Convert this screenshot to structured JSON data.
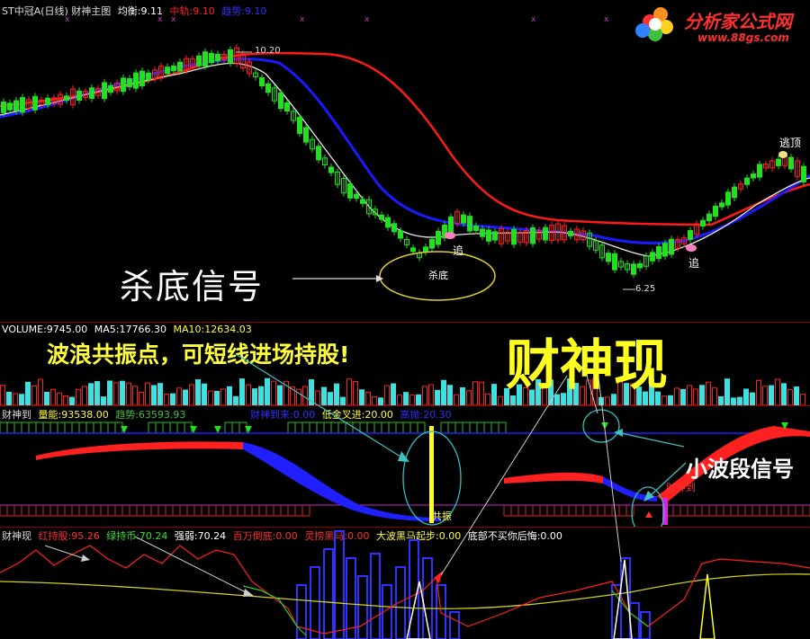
{
  "main": {
    "title": "ST中冠A(日线) 财神主图",
    "avg_label": "均衡:9.11",
    "mid_label": "中轨:9.10",
    "trend_label": "趋势:9.10",
    "high_label": "10.20",
    "low_label": "6.25",
    "chase1": "追",
    "chase2": "追",
    "kill_bottom": "杀底",
    "escape_top": "逃顶",
    "annotation_kill": "杀底信号"
  },
  "volume": {
    "vol_label": "VOLUME:9745.00",
    "ma5_label": "MA5:17766.30",
    "ma10_label": "MA10:12634.03"
  },
  "caishendao": {
    "title": "财神到",
    "energy_label": "量能:93538.00",
    "trend_label": "趋势:63593.93",
    "appear_label": "财神到来:0.00",
    "golden_label": "低金叉进:20.00",
    "high_label": "高抛:20.30",
    "resonance": "共振",
    "arrive": "财神到"
  },
  "caishenxian": {
    "title": "财神现",
    "red_label": "红持股:95.26",
    "green_label": "绿持币:70.24",
    "strong_label": "强弱:70.24",
    "million_label": "百万倒底:0.00",
    "dark_label": "灵捞黑马:0.00",
    "wave_label": "大波黑马起步:0.00",
    "bottom_label": "底部不买你后悔:0.00"
  },
  "annotations": {
    "resonance_text": "波浪共振点，可短线进场持股!",
    "caishen_text": "财神现",
    "small_wave_text": "小波段信号"
  },
  "logo": {
    "name": "分析家公式网",
    "url": "www.88gs.com"
  }
}
